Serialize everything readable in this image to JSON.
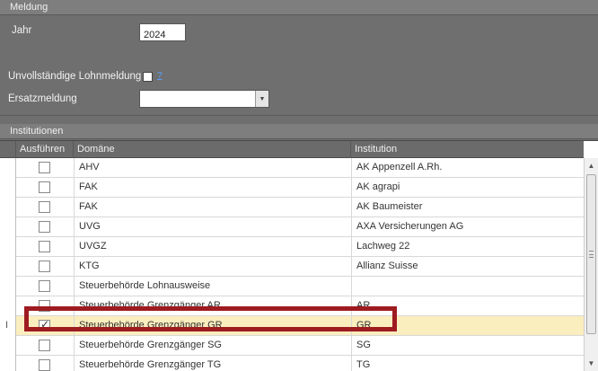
{
  "meldung": {
    "header": "Meldung",
    "jahr_label": "Jahr",
    "jahr_value": "2024",
    "unvollstaendig_label": "Unvollständige Lohnmeldung",
    "help_text": "?",
    "ersatz_label": "Ersatzmeldung",
    "ersatz_value": ""
  },
  "institutionen": {
    "header": "Institutionen",
    "columns": [
      "Ausführen",
      "Domäne",
      "Institution"
    ],
    "rows": [
      {
        "indicator": "",
        "checked": false,
        "domain": "AHV",
        "institution": "AK Appenzell A.Rh."
      },
      {
        "indicator": "",
        "checked": false,
        "domain": "FAK",
        "institution": "AK agrapi"
      },
      {
        "indicator": "",
        "checked": false,
        "domain": "FAK",
        "institution": "AK Baumeister"
      },
      {
        "indicator": "",
        "checked": false,
        "domain": "UVG",
        "institution": "AXA Versicherungen AG"
      },
      {
        "indicator": "",
        "checked": false,
        "domain": "UVGZ",
        "institution": "Lachweg 22"
      },
      {
        "indicator": "",
        "checked": false,
        "domain": "KTG",
        "institution": "Allianz Suisse"
      },
      {
        "indicator": "",
        "checked": false,
        "domain": "Steuerbehörde Lohnausweise",
        "institution": ""
      },
      {
        "indicator": "",
        "checked": false,
        "domain": "Steuerbehörde Grenzgänger AR",
        "institution": "AR"
      },
      {
        "indicator": "I",
        "checked": true,
        "domain": "Steuerbehörde Grenzgänger GR",
        "institution": "GR",
        "selected": true
      },
      {
        "indicator": "",
        "checked": false,
        "domain": "Steuerbehörde Grenzgänger SG",
        "institution": "SG"
      },
      {
        "indicator": "",
        "checked": false,
        "domain": "Steuerbehörde Grenzgänger TG",
        "institution": "TG"
      }
    ]
  },
  "colors": {
    "highlight": "#9e1b20",
    "selected_row": "#fbeebe"
  }
}
